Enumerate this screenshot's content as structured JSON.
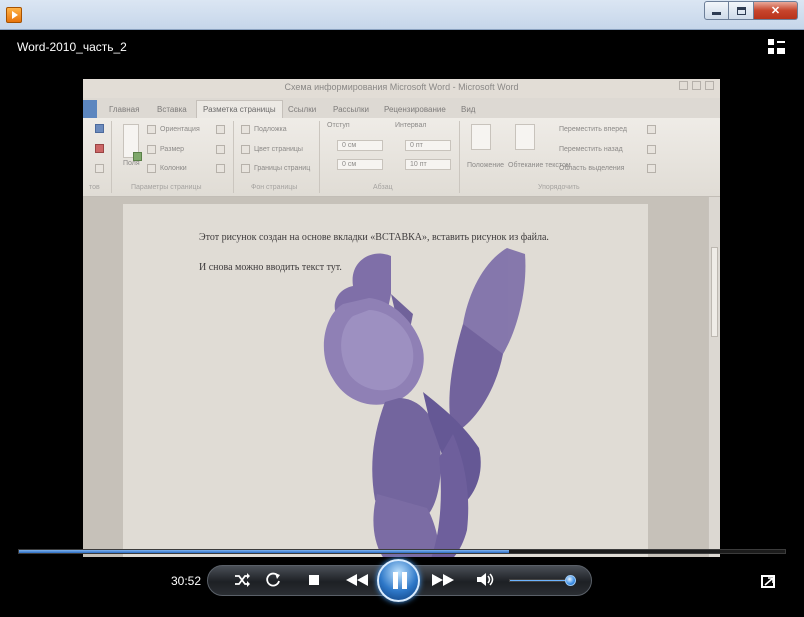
{
  "window": {
    "app_title": "Word-2010_часть_2"
  },
  "video_frame": {
    "word_title": "Схема информирования  Microsoft Word - Microsoft Word",
    "tabs": [
      "Главная",
      "Вставка",
      "Разметка страницы",
      "Ссылки",
      "Рассылки",
      "Рецензирование",
      "Вид"
    ],
    "active_tab_index": 2,
    "ribbon": {
      "orientation": "Ориентация",
      "size": "Размер",
      "columns": "Колонки",
      "fields_short": "Поля",
      "group_page_params": "Параметры страницы",
      "watermark": "Подложка",
      "page_color": "Цвет страницы",
      "page_borders": "Границы страниц",
      "group_background": "Фон страницы",
      "indent_label": "Отступ",
      "interval_label": "Интервал",
      "indent_left": "0 см",
      "indent_right": "0 см",
      "interval_before": "0 пт",
      "interval_after": "10 пт",
      "group_paragraph": "Абзац",
      "position": "Положение",
      "wrap_text": "Обтекание текстом",
      "bring_forward": "Переместить вперед",
      "send_backward": "Переместить назад",
      "selection_pane": "Область выделения",
      "group_arrange": "Упорядочить",
      "misc_text": "тов"
    },
    "doc_line_1": "Этот рисунок создан на основе вкладки «ВСТАВКА», вставить рисунок из файла.",
    "doc_line_2": "И снова можно вводить текст тут."
  },
  "player": {
    "elapsed_time": "30:52",
    "progress": 0.64,
    "volume": 0.92,
    "state": "playing"
  },
  "colors": {
    "accent": "#2f6fc4",
    "flower": "#7a6aa6"
  },
  "icons": {
    "shuffle": "shuffle-icon",
    "repeat": "repeat-icon",
    "stop": "stop-icon",
    "previous": "rewind-icon",
    "play_pause": "pause-icon",
    "next": "fast-forward-icon",
    "mute": "speaker-icon",
    "switch_view": "switch-to-library-icon",
    "fullscreen": "fullscreen-icon"
  }
}
